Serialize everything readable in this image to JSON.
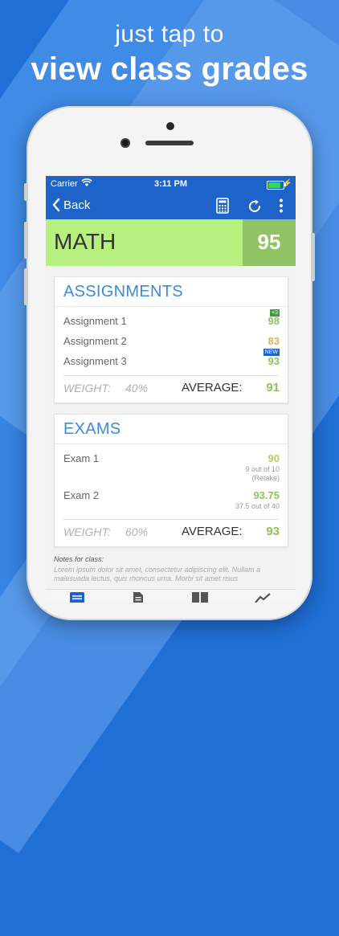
{
  "promo": {
    "line1": "just tap to",
    "line2": "view class grades"
  },
  "status": {
    "carrier": "Carrier",
    "time": "3:11 PM"
  },
  "nav": {
    "back_label": "Back"
  },
  "subject": {
    "name": "MATH",
    "grade": "95"
  },
  "assignments": {
    "title": "ASSIGNMENTS",
    "items": [
      {
        "name": "Assignment 1",
        "score": "98",
        "badge": "+3"
      },
      {
        "name": "Assignment 2",
        "score": "83"
      },
      {
        "name": "Assignment 3",
        "score": "93",
        "badge": "NEW"
      }
    ],
    "weight_label": "WEIGHT:",
    "weight": "40%",
    "average_label": "AVERAGE:",
    "average": "91"
  },
  "exams": {
    "title": "EXAMS",
    "items": [
      {
        "name": "Exam 1",
        "score": "90",
        "detail": "9 out of 10",
        "note": "(Retake)"
      },
      {
        "name": "Exam 2",
        "score": "93.75",
        "detail": "37.5 out of 40"
      }
    ],
    "weight_label": "WEIGHT:",
    "weight": "60%",
    "average_label": "AVERAGE:",
    "average": "93"
  },
  "notes": {
    "title": "Notes for class:",
    "body": "Lorem ipsum dolor sit amet, consectetur adipiscing elit. Nullam a malesuada lectus, quis rhoncus uma. Morbi sit amet risus"
  },
  "colors": {
    "brand_blue": "#1e63c9",
    "subject_green": "#b7f07e",
    "grade_green": "#90c364",
    "score_green": "#8fc35a",
    "score_orange": "#e0b45a",
    "title_blue": "#3b8ad8"
  },
  "icons": [
    "back-chevron-icon",
    "calculator-icon",
    "refresh-icon",
    "more-vertical-icon",
    "wifi-icon",
    "battery-icon",
    "tab-grades-icon",
    "tab-document-icon",
    "tab-book-icon",
    "tab-trend-icon"
  ]
}
